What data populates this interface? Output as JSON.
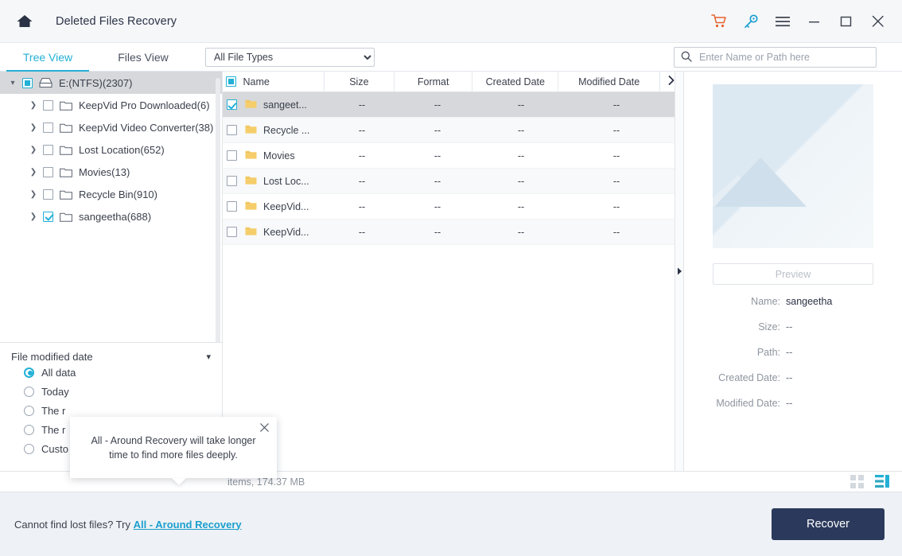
{
  "titlebar": {
    "app_title": "Deleted Files Recovery",
    "home_icon": "home-icon",
    "actions": [
      {
        "name": "cart-icon",
        "label": "",
        "color": "#e8622c"
      },
      {
        "name": "key-icon",
        "label": "",
        "color": "#1a9fce"
      },
      {
        "name": "hamburger-menu-icon",
        "label": "",
        "color": "#3a3f4b"
      },
      {
        "name": "minimize-icon",
        "label": "",
        "color": "#3a3f4b"
      },
      {
        "name": "maximize-icon",
        "label": "",
        "color": "#3a3f4b"
      },
      {
        "name": "close-icon",
        "label": "",
        "color": "#3a3f4b"
      }
    ]
  },
  "toolbar": {
    "tabs": [
      {
        "label": "Tree View",
        "active": true
      },
      {
        "label": "Files View",
        "active": false
      }
    ],
    "filetype": {
      "selected": "All File Types",
      "options": [
        "All File Types"
      ]
    },
    "search": {
      "placeholder": "Enter Name or Path here",
      "value": "",
      "icon": "search-icon"
    }
  },
  "tree": {
    "root": {
      "label": "E:(NTFS)(2307)",
      "checkbox": "partial",
      "expanded": true,
      "icon": "drive-icon"
    },
    "children": [
      {
        "label": "KeepVid Pro Downloaded(6)",
        "checkbox": "unchecked",
        "icon": "folder-icon"
      },
      {
        "label": "KeepVid Video Converter(38)",
        "checkbox": "unchecked",
        "icon": "folder-icon"
      },
      {
        "label": "Lost Location(652)",
        "checkbox": "unchecked",
        "icon": "folder-icon"
      },
      {
        "label": "Movies(13)",
        "checkbox": "unchecked",
        "icon": "folder-icon"
      },
      {
        "label": "Recycle Bin(910)",
        "checkbox": "unchecked",
        "icon": "folder-icon"
      },
      {
        "label": "sangeetha(688)",
        "checkbox": "checked",
        "icon": "folder-icon"
      }
    ]
  },
  "filter": {
    "title": "File modified date",
    "chevron": "chevron-down-icon",
    "options": [
      {
        "label": "All data",
        "selected": true
      },
      {
        "label": "Today",
        "selected": false
      },
      {
        "label": "The r",
        "selected": false
      },
      {
        "label": "The r",
        "selected": false
      },
      {
        "label": "Custo",
        "selected": false
      }
    ]
  },
  "filelist": {
    "columns": [
      "Name",
      "Size",
      "Format",
      "Created Date",
      "Modified Date"
    ],
    "select_all_checkbox": "partial",
    "more_columns_icon": "chevron-right-icon",
    "rows": [
      {
        "name": "sangeet...",
        "size": "--",
        "format": "--",
        "created": "--",
        "modified": "--",
        "checked": true,
        "selected": true
      },
      {
        "name": "Recycle ...",
        "size": "--",
        "format": "--",
        "created": "--",
        "modified": "--",
        "checked": false,
        "selected": false
      },
      {
        "name": "Movies",
        "size": "--",
        "format": "--",
        "created": "--",
        "modified": "--",
        "checked": false,
        "selected": false
      },
      {
        "name": "Lost Loc...",
        "size": "--",
        "format": "--",
        "created": "--",
        "modified": "--",
        "checked": false,
        "selected": false
      },
      {
        "name": "KeepVid...",
        "size": "--",
        "format": "--",
        "created": "--",
        "modified": "--",
        "checked": false,
        "selected": false
      },
      {
        "name": "KeepVid...",
        "size": "--",
        "format": "--",
        "created": "--",
        "modified": "--",
        "checked": false,
        "selected": false
      }
    ]
  },
  "collapse_handle": {
    "icon": "collapse-right-icon"
  },
  "preview": {
    "thumbnail": "image-placeholder",
    "button_label": "Preview",
    "fields": [
      {
        "label": "Name:",
        "value": "sangeetha"
      },
      {
        "label": "Size:",
        "value": "--"
      },
      {
        "label": "Path:",
        "value": "--"
      },
      {
        "label": "Created Date:",
        "value": "--"
      },
      {
        "label": "Modified Date:",
        "value": "--"
      }
    ]
  },
  "statusbar": {
    "text": "items, 174.37 MB",
    "view_grid_icon": "grid-view-icon",
    "view_list_icon": "list-view-icon",
    "active_view": "list"
  },
  "tooltip": {
    "text": "All - Around Recovery will take longer time to find more files deeply.",
    "close_icon": "close-icon"
  },
  "bottombar": {
    "hint_prefix": "Cannot find lost files? Try ",
    "hint_link": "All - Around Recovery",
    "recover_label": "Recover"
  },
  "colors": {
    "accent": "#23b0d6",
    "link": "#1a9fce",
    "cart": "#e8622c",
    "recover_bg": "#2b3a5c",
    "folder": "#f5cd6a"
  }
}
